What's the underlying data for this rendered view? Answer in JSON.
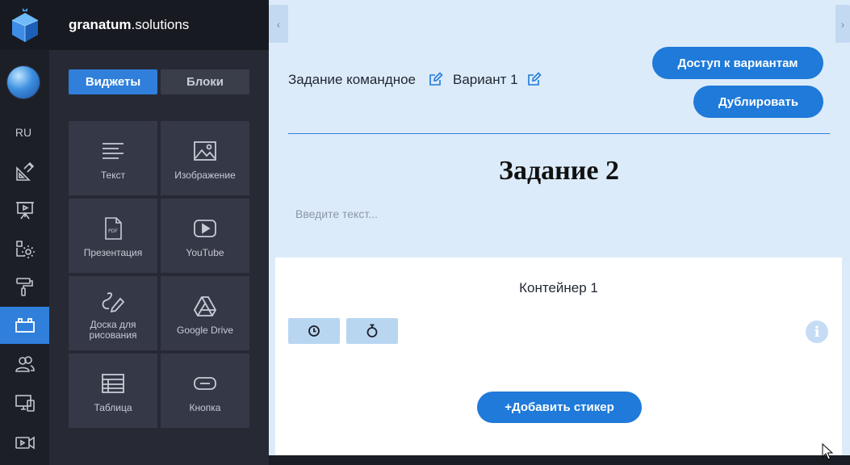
{
  "brand": {
    "bold": "granatum",
    "light": ".solutions"
  },
  "rail": {
    "lang": "RU",
    "items": [
      {
        "icon": "ruler-pencil-icon"
      },
      {
        "icon": "presentation-icon"
      },
      {
        "icon": "settings-gear-icon"
      },
      {
        "icon": "paint-roller-icon"
      },
      {
        "icon": "blocks-icon",
        "active": true
      },
      {
        "icon": "users-icon"
      },
      {
        "icon": "devices-icon"
      },
      {
        "icon": "video-camera-icon"
      }
    ]
  },
  "panel": {
    "tabs": {
      "widgets": "Виджеты",
      "blocks": "Блоки"
    },
    "widgets": [
      {
        "label": "Текст",
        "icon": "text-lines-icon"
      },
      {
        "label": "Изображение",
        "icon": "image-icon"
      },
      {
        "label": "Презентация",
        "icon": "pdf-file-icon"
      },
      {
        "label": "YouTube",
        "icon": "youtube-icon"
      },
      {
        "label": "Доска для рисования",
        "icon": "drawing-board-icon"
      },
      {
        "label": "Google Drive",
        "icon": "google-drive-icon"
      },
      {
        "label": "Таблица",
        "icon": "table-icon"
      },
      {
        "label": "Кнопка",
        "icon": "button-icon"
      }
    ]
  },
  "main": {
    "task_name": "Задание командное",
    "variant_name": "Вариант 1",
    "buttons": {
      "access": "Доступ к вариантам",
      "duplicate": "Дублировать"
    },
    "heading": "Задание 2",
    "text_placeholder": "Введите текст...",
    "container": {
      "title": "Контейнер 1",
      "add_sticker": "+Добавить стикер"
    }
  },
  "colors": {
    "accent": "#1f7ad9",
    "rail_active": "#2f7fdb",
    "main_bg": "#dcebfa",
    "panel_bg": "#272a35"
  }
}
